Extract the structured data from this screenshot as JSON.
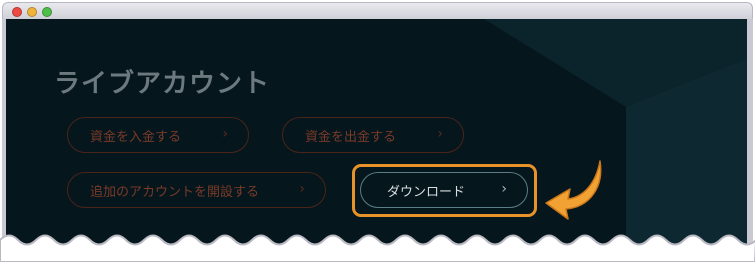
{
  "window": {
    "controls": [
      "close",
      "minimize",
      "maximize"
    ]
  },
  "page": {
    "title": "ライブアカウント"
  },
  "buttons": {
    "deposit": "資金を入金する",
    "withdraw": "資金を出金する",
    "open_account": "追加のアカウントを開設する",
    "download": "ダウンロード"
  },
  "icons": {
    "chevron": "›"
  },
  "colors": {
    "background": "#06161d",
    "highlight": "#e8922a",
    "title": "#6c7a80",
    "button_border_dim": "#4a2419",
    "download_border": "#5a7d86"
  }
}
